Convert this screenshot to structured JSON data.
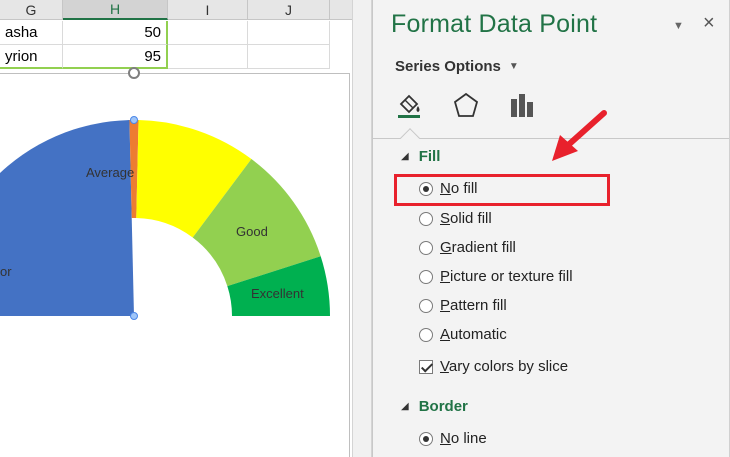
{
  "sheet": {
    "columns": [
      "G",
      "H",
      "I",
      "J"
    ],
    "rows": [
      {
        "name": "asha",
        "value": "50"
      },
      {
        "name": "yrion",
        "value": "95"
      }
    ]
  },
  "chart_data": {
    "type": "pie",
    "title": "",
    "slices": [
      {
        "label": "Poor",
        "value": 50,
        "color": "#4472c4"
      },
      {
        "label": "",
        "value": 1.5,
        "color": "#ed7d31"
      },
      {
        "label": "Average",
        "value": 20,
        "color": "#ffff00"
      },
      {
        "label": "Good",
        "value": 20,
        "color": "#92d050"
      },
      {
        "label": "Excellent",
        "value": 10,
        "color": "#00b050"
      }
    ],
    "visible_labels": [
      "Average",
      "Good",
      "Excellent",
      "or"
    ]
  },
  "pane": {
    "title": "Format Data Point",
    "close": "×",
    "series_options": "Series Options",
    "tabs": [
      {
        "name": "fill-line-icon"
      },
      {
        "name": "effects-pentagon-icon"
      },
      {
        "name": "series-options-bars-icon"
      }
    ],
    "fill_section": {
      "header": "Fill",
      "options": [
        {
          "label": "No fill",
          "ul": "N",
          "rest": "o fill",
          "selected": true
        },
        {
          "label": "Solid fill",
          "ul": "S",
          "rest": "olid fill",
          "selected": false
        },
        {
          "label": "Gradient fill",
          "ul": "G",
          "rest": "radient fill",
          "selected": false
        },
        {
          "label": "Picture or texture fill",
          "ul": "P",
          "rest": "icture or texture fill",
          "selected": false
        },
        {
          "label": "Pattern fill",
          "ul": "P",
          "rest": "attern fill",
          "selected": false
        },
        {
          "label": "Automatic",
          "ul": "A",
          "rest": "utomatic",
          "selected": false
        }
      ],
      "vary_colors": {
        "ul": "V",
        "rest": "ary colors by slice",
        "checked": true
      }
    },
    "border_section": {
      "header": "Border",
      "options": [
        {
          "ul": "N",
          "rest": "o line",
          "selected": true
        }
      ]
    }
  },
  "colors": {
    "accent": "#217346",
    "highlight": "#e8212c"
  }
}
